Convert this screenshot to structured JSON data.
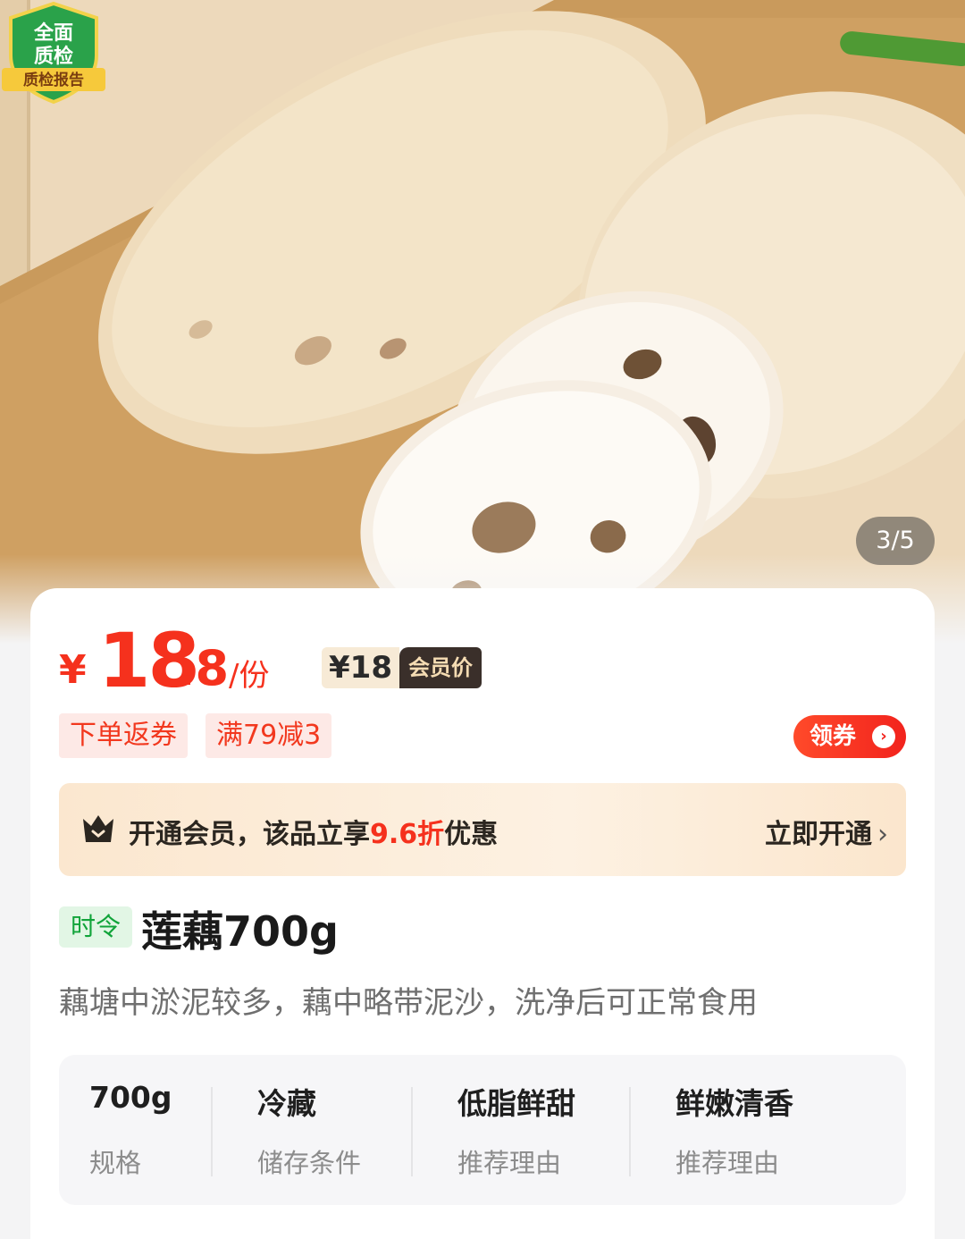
{
  "gallery": {
    "page_indicator": "3/5",
    "qc_badge": {
      "line1": "全面",
      "line2": "质检",
      "ribbon": "质检报告"
    }
  },
  "price": {
    "currency": "¥",
    "integer": "18",
    "decimal": ".8",
    "unit": "/份",
    "member_value": "¥18",
    "member_tag": "会员价"
  },
  "coupons": {
    "tags": [
      "下单返券",
      "满79减3"
    ],
    "get_coupon_label": "领券"
  },
  "vip": {
    "text_prefix": "开通会员，该品立享",
    "discount": "9.6折",
    "text_suffix": "优惠",
    "open_label": "立即开通"
  },
  "product": {
    "season_tag": "时令",
    "name": "莲藕700g",
    "description": "藕塘中淤泥较多，藕中略带泥沙，洗净后可正常食用"
  },
  "attributes": [
    {
      "value": "700g",
      "label": "规格"
    },
    {
      "value": "冷藏",
      "label": "储存条件"
    },
    {
      "value": "低脂鲜甜",
      "label": "推荐理由"
    },
    {
      "value": "鲜嫩清香",
      "label": "推荐理由"
    }
  ],
  "colors": {
    "price_red": "#f5311d",
    "season_green": "#11a43a",
    "vip_gold_bg": "#fbe7cf"
  }
}
